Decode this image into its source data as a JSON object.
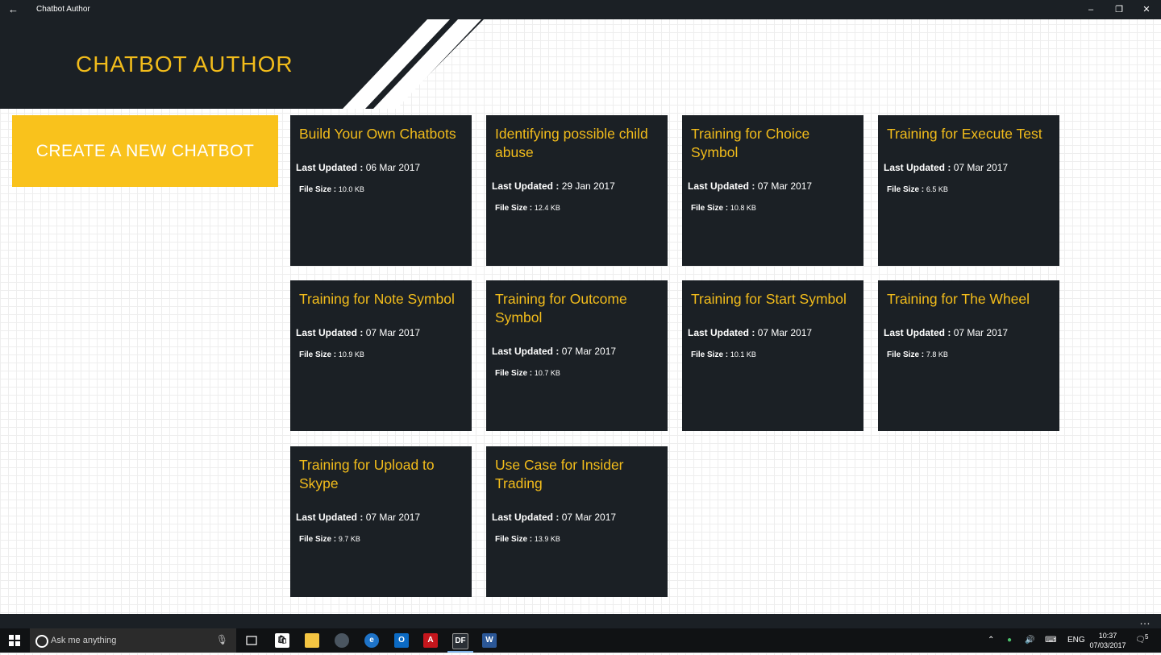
{
  "window": {
    "title": "Chatbot Author",
    "back_icon": "←",
    "minimize_icon": "–",
    "restore_icon": "❐",
    "close_icon": "✕"
  },
  "header": {
    "app_title": "CHATBOT AUTHOR"
  },
  "create_button": {
    "label": "CREATE A NEW CHATBOT"
  },
  "labels": {
    "last_updated": "Last Updated :",
    "file_size": "File Size :"
  },
  "projects": [
    {
      "title": "Build Your Own Chatbots",
      "last_updated": "06 Mar 2017",
      "file_size": "10.0 KB"
    },
    {
      "title": "Identifying possible child abuse",
      "last_updated": "29 Jan 2017",
      "file_size": "12.4 KB"
    },
    {
      "title": "Training for Choice Symbol",
      "last_updated": "07 Mar 2017",
      "file_size": "10.8 KB"
    },
    {
      "title": "Training for Execute Test",
      "last_updated": "07 Mar 2017",
      "file_size": "6.5 KB"
    },
    {
      "title": "Training for Note Symbol",
      "last_updated": "07 Mar 2017",
      "file_size": "10.9 KB"
    },
    {
      "title": "Training for Outcome Symbol",
      "last_updated": "07 Mar 2017",
      "file_size": "10.7 KB"
    },
    {
      "title": "Training for Start Symbol",
      "last_updated": "07 Mar 2017",
      "file_size": "10.1 KB"
    },
    {
      "title": "Training for The Wheel",
      "last_updated": "07 Mar 2017",
      "file_size": "7.8 KB"
    },
    {
      "title": "Training for Upload to Skype",
      "last_updated": "07 Mar 2017",
      "file_size": "9.7 KB"
    },
    {
      "title": "Use Case for Insider Trading",
      "last_updated": "07 Mar 2017",
      "file_size": "13.9 KB"
    }
  ],
  "app_bar": {
    "more_icon": "…"
  },
  "taskbar": {
    "search_placeholder": "Ask me anything",
    "language": "ENG",
    "time": "10:37",
    "date": "07/03/2017",
    "notification_count": "5",
    "pinned_apps": [
      "task-view",
      "store",
      "file-explorer",
      "app",
      "edge",
      "outlook",
      "acrobat",
      "df-app",
      "word"
    ]
  },
  "colors": {
    "dark": "#1b2025",
    "accent": "#f2bc1b",
    "button": "#f9c21c"
  }
}
